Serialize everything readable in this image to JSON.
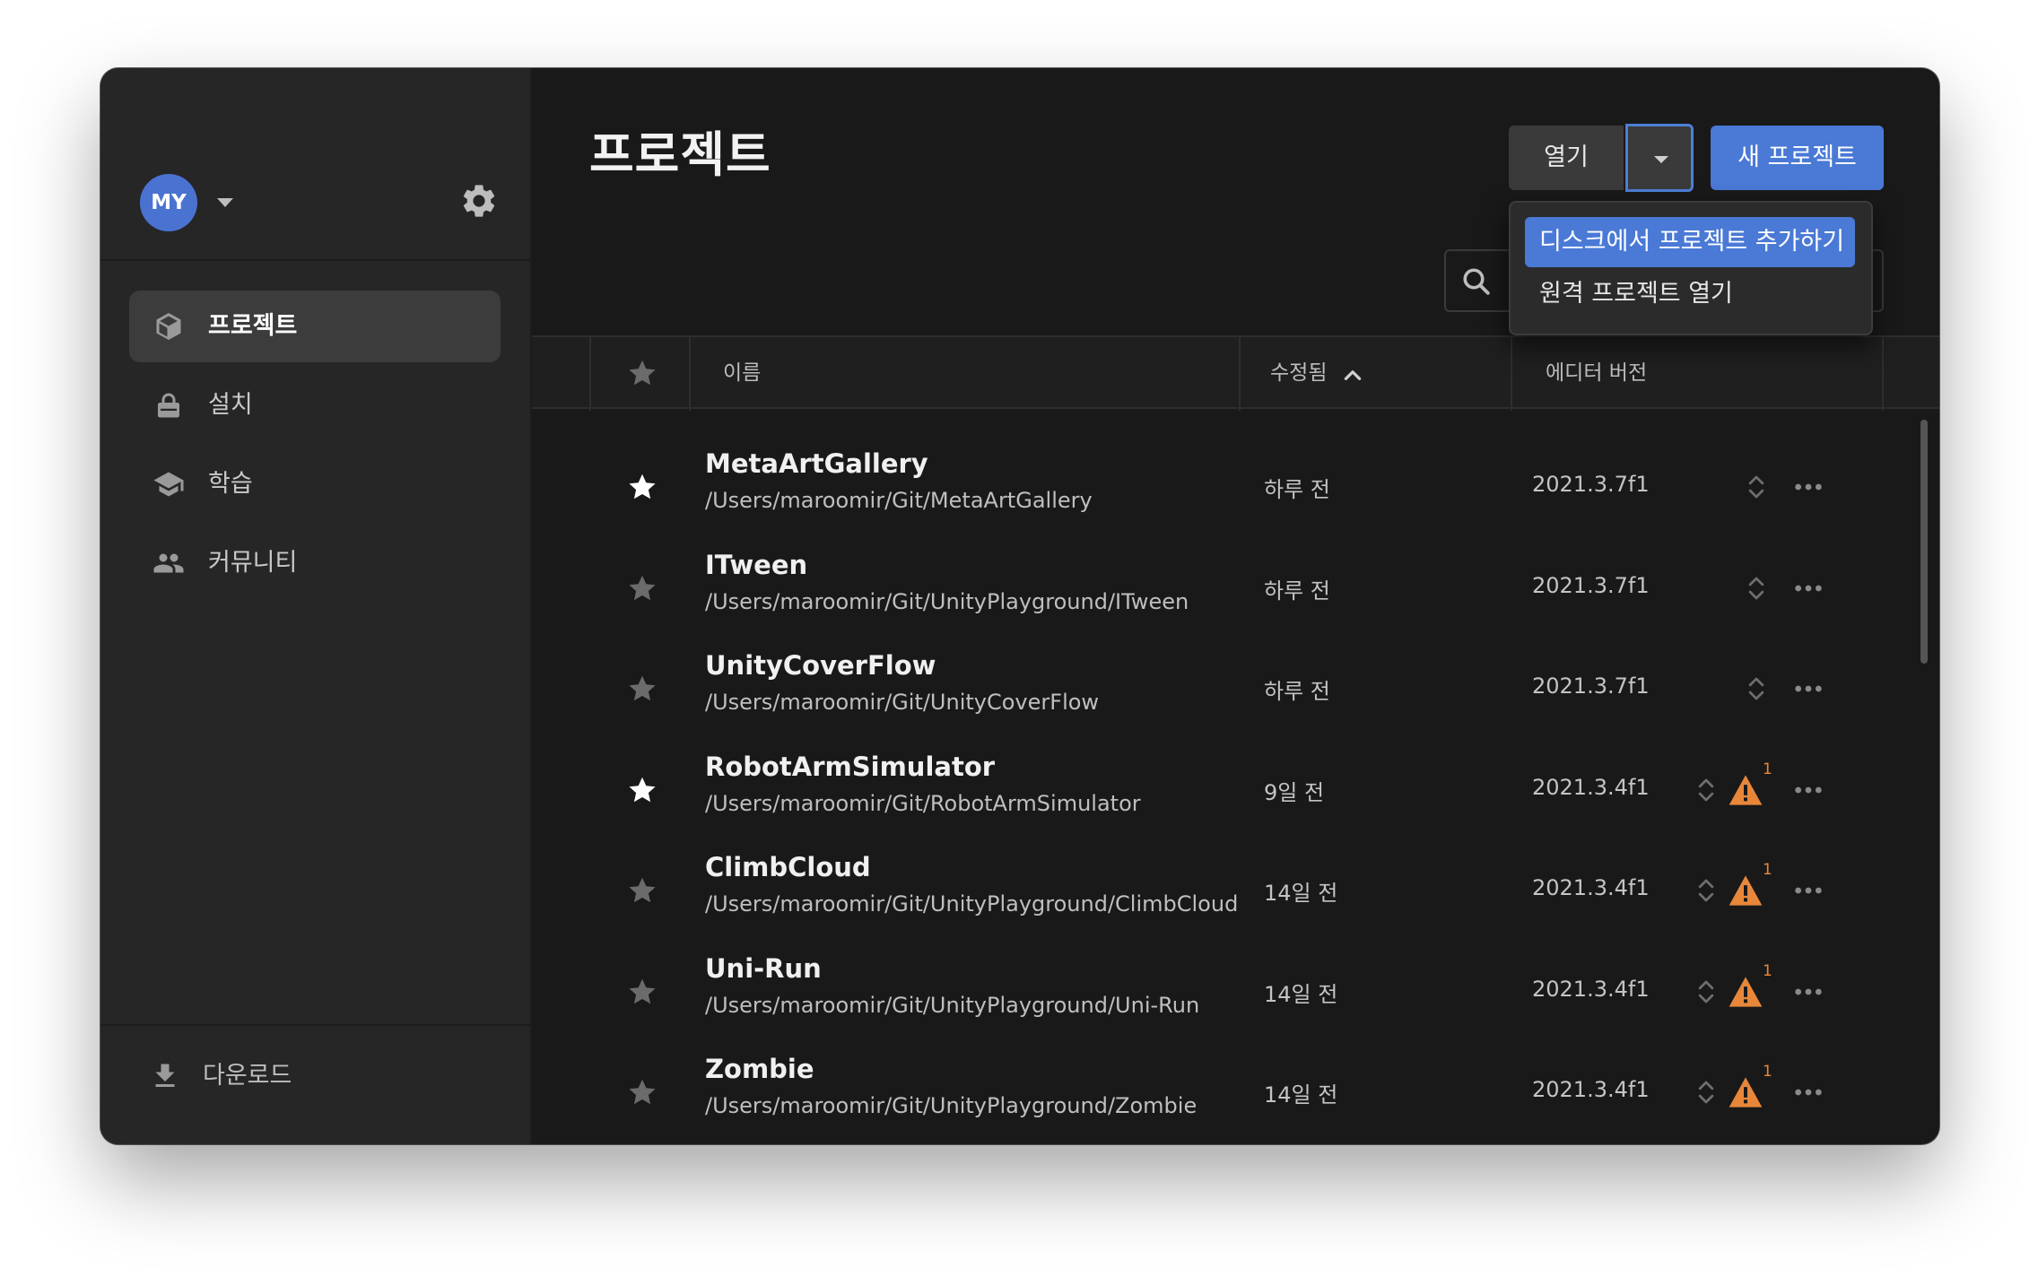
{
  "window": {
    "traffic_lights": [
      "close",
      "minimize",
      "zoom"
    ]
  },
  "sidebar": {
    "account_initials": "MY",
    "items": [
      {
        "label": "프로젝트",
        "icon": "cube-icon",
        "active": true
      },
      {
        "label": "설치",
        "icon": "lock-icon",
        "active": false
      },
      {
        "label": "학습",
        "icon": "graduation-cap-icon",
        "active": false
      },
      {
        "label": "커뮤니티",
        "icon": "people-icon",
        "active": false
      }
    ],
    "download_label": "다운로드"
  },
  "main": {
    "title": "프로젝트",
    "open_button": "열기",
    "new_project_button": "새 프로젝트",
    "dropdown": {
      "items": [
        "디스크에서 프로젝트 추가하기",
        "원격 프로젝트 열기"
      ],
      "highlighted_index": 0
    },
    "table": {
      "headers": {
        "name": "이름",
        "modified": "수정됨",
        "editor_version": "에디터 버전"
      },
      "sort": {
        "column": "modified",
        "direction": "asc"
      },
      "rows": [
        {
          "name": "MetaArtGallery",
          "path": "/Users/maroomir/Git/MetaArtGallery",
          "modified": "하루 전",
          "version": "2021.3.7f1",
          "starred": true,
          "warning_count": null
        },
        {
          "name": "ITween",
          "path": "/Users/maroomir/Git/UnityPlayground/ITween",
          "modified": "하루 전",
          "version": "2021.3.7f1",
          "starred": false,
          "warning_count": null
        },
        {
          "name": "UnityCoverFlow",
          "path": "/Users/maroomir/Git/UnityCoverFlow",
          "modified": "하루 전",
          "version": "2021.3.7f1",
          "starred": false,
          "warning_count": null
        },
        {
          "name": "RobotArmSimulator",
          "path": "/Users/maroomir/Git/RobotArmSimulator",
          "modified": "9일 전",
          "version": "2021.3.4f1",
          "starred": true,
          "warning_count": "1"
        },
        {
          "name": "ClimbCloud",
          "path": "/Users/maroomir/Git/UnityPlayground/ClimbCloud",
          "modified": "14일 전",
          "version": "2021.3.4f1",
          "starred": false,
          "warning_count": "1"
        },
        {
          "name": "Uni-Run",
          "path": "/Users/maroomir/Git/UnityPlayground/Uni-Run",
          "modified": "14일 전",
          "version": "2021.3.4f1",
          "starred": false,
          "warning_count": "1"
        },
        {
          "name": "Zombie",
          "path": "/Users/maroomir/Git/UnityPlayground/Zombie",
          "modified": "14일 전",
          "version": "2021.3.4f1",
          "starred": false,
          "warning_count": "1"
        }
      ]
    }
  },
  "colors": {
    "accent": "#4a79d6",
    "warning": "#e8873a",
    "star_active": "#ffffff",
    "star_inactive": "#6b6b6b"
  }
}
